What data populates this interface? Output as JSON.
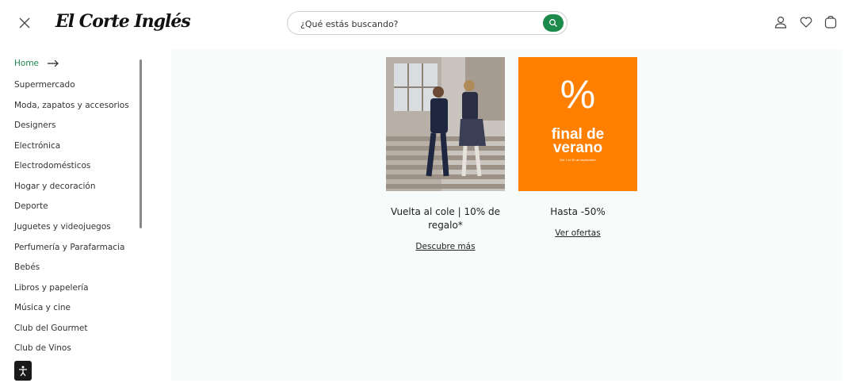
{
  "header": {
    "logo_text": "El Corte Inglés",
    "search_placeholder": "¿Qué estás buscando?"
  },
  "sidebar": {
    "items": [
      {
        "label": "Home"
      },
      {
        "label": "Supermercado"
      },
      {
        "label": "Moda, zapatos y accesorios"
      },
      {
        "label": "Designers"
      },
      {
        "label": "Electrónica"
      },
      {
        "label": "Electrodomésticos"
      },
      {
        "label": "Hogar y decoración"
      },
      {
        "label": "Deporte"
      },
      {
        "label": "Juguetes y videojuegos"
      },
      {
        "label": "Perfumería y Parafarmacia"
      },
      {
        "label": "Bebés"
      },
      {
        "label": "Libros y papelería"
      },
      {
        "label": "Música y cine"
      },
      {
        "label": "Club del Gourmet"
      },
      {
        "label": "Club de Vinos"
      }
    ]
  },
  "cards": [
    {
      "title": "Vuelta al cole | 10% de regalo*",
      "link": "Descubre más"
    },
    {
      "title": "Hasta -50%",
      "link": "Ver ofertas",
      "promo_symbol": "%",
      "promo_line1": "final de",
      "promo_line2": "verano",
      "promo_small": "Del 1 al 30 de septiembre"
    }
  ],
  "colors": {
    "accent": "#1b8a4a",
    "promo": "#ff7f00"
  }
}
